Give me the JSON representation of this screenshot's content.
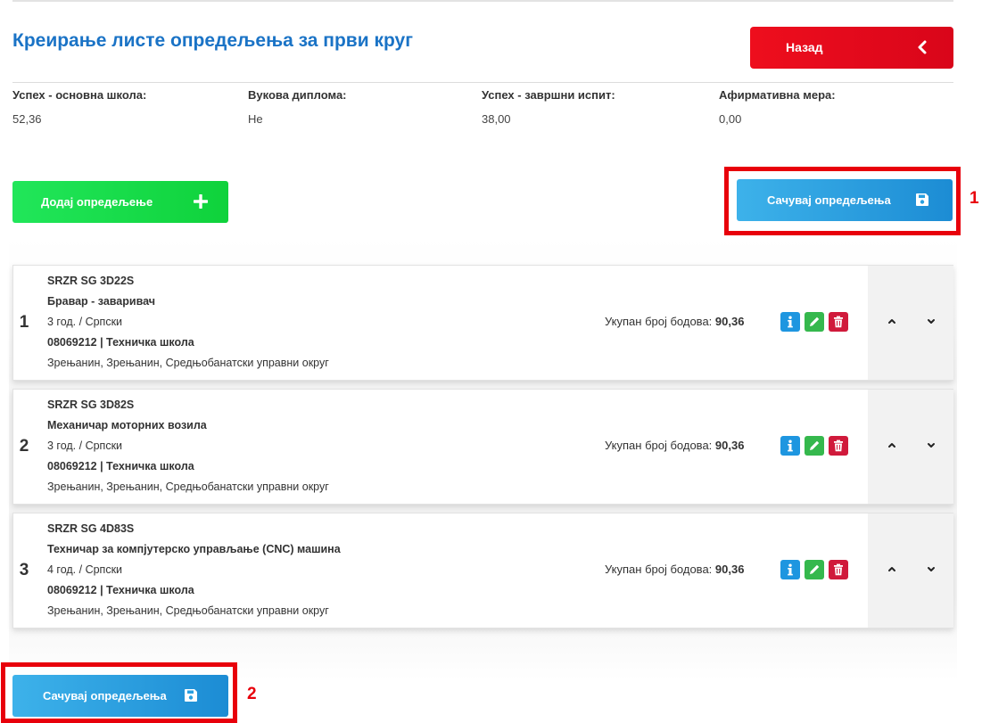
{
  "page": {
    "title": "Креирање листе опредељења за први круг",
    "back_label": "Назад"
  },
  "summary": [
    {
      "label": "Успех - основна школа:",
      "value": "52,36"
    },
    {
      "label": "Вукова диплома:",
      "value": "Не"
    },
    {
      "label": "Успех - завршни испит:",
      "value": "38,00"
    },
    {
      "label": "Афирмативна мера:",
      "value": "0,00"
    }
  ],
  "actions": {
    "add_label": "Додај опредељење",
    "save_label": "Сачувај опредељења"
  },
  "annotations": {
    "marker_1": "1",
    "marker_2": "2"
  },
  "choices": [
    {
      "index": "1",
      "code": "SRZR SG 3D22S",
      "profile": "Бравар - заваривач",
      "duration": "3 год. / Српски",
      "school": "08069212 | Техничка школа",
      "location": "Зрењанин, Зрењанин, Средњобанатски управни округ",
      "points_label": "Укупан број бодова:",
      "points": "90,36"
    },
    {
      "index": "2",
      "code": "SRZR SG 3D82S",
      "profile": "Механичар моторних возила",
      "duration": "3 год. / Српски",
      "school": "08069212 | Техничка школа",
      "location": "Зрењанин, Зрењанин, Средњобанатски управни округ",
      "points_label": "Укупан број бодова:",
      "points": "90,36"
    },
    {
      "index": "3",
      "code": "SRZR SG 4D83S",
      "profile": "Техничар за компјутерско управљање (CNC) машина",
      "duration": "4 год. / Српски",
      "school": "08069212 | Техничка школа",
      "location": "Зрењанин, Зрењанин, Средњобанатски управни округ",
      "points_label": "Укупан број бодова:",
      "points": "90,36"
    }
  ],
  "icons": {
    "back": "chevron-left-icon",
    "add": "plus-icon",
    "save": "floppy-disk-icon",
    "info": "info-icon",
    "edit": "pencil-icon",
    "delete": "trash-icon",
    "up": "chevron-up-icon",
    "down": "chevron-down-icon"
  },
  "colors": {
    "title": "#1a73c6",
    "back": "#e60c1c",
    "add": "#18dc47",
    "save": "#2a9fe0",
    "info": "#1e96e0",
    "edit": "#35b84d",
    "delete": "#d01a3b",
    "highlight": "#e8000b"
  }
}
